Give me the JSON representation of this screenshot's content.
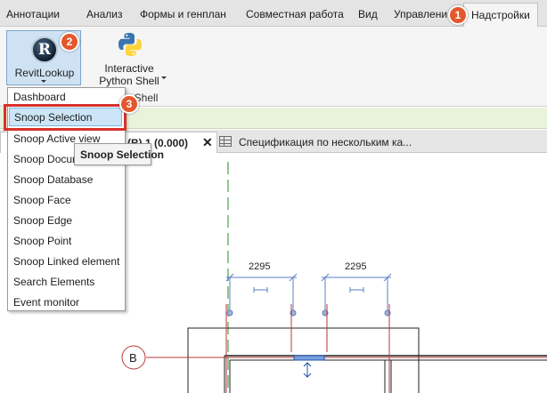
{
  "ribbon_tabs": [
    {
      "label": "Аннотации"
    },
    {
      "label": "Анализ"
    },
    {
      "label": "Формы и генплан"
    },
    {
      "label": "Совместная работа"
    },
    {
      "label": "Вид"
    },
    {
      "label": "Управлени"
    },
    {
      "label": "Надстройки"
    }
  ],
  "ribbon": {
    "revitlookup_label": "RevitLookup",
    "python_label_line1": "Interactive",
    "python_label_line2": "Python Shell",
    "group_label": "nShell"
  },
  "menu": {
    "items": [
      {
        "label": "Dashboard"
      },
      {
        "label": "Snoop Selection"
      },
      {
        "label": "Snoop Active view"
      },
      {
        "label": "Snoop Docum"
      },
      {
        "label": "Snoop Database"
      },
      {
        "label": "Snoop Face"
      },
      {
        "label": "Snoop Edge"
      },
      {
        "label": "Snoop Point"
      },
      {
        "label": "Snoop Linked element"
      },
      {
        "label": "Search Elements"
      },
      {
        "label": "Event monitor"
      }
    ]
  },
  "tooltip": "Snoop Selection",
  "view_tabs": [
    {
      "label": "(B) 1 (0.000)"
    },
    {
      "label": "Спецификация по нескольким ка..."
    }
  ],
  "drawing": {
    "dim_left": "2295",
    "dim_right": "2295",
    "grid_label": "B"
  },
  "annotations": {
    "badge_1": "1",
    "badge_2": "2",
    "badge_3": "3"
  },
  "colors": {
    "accent_red": "#d9302a",
    "badge_orange": "#e4572c",
    "highlight_blue": "#cce6f7",
    "dimension_blue": "#5b7fc4"
  }
}
